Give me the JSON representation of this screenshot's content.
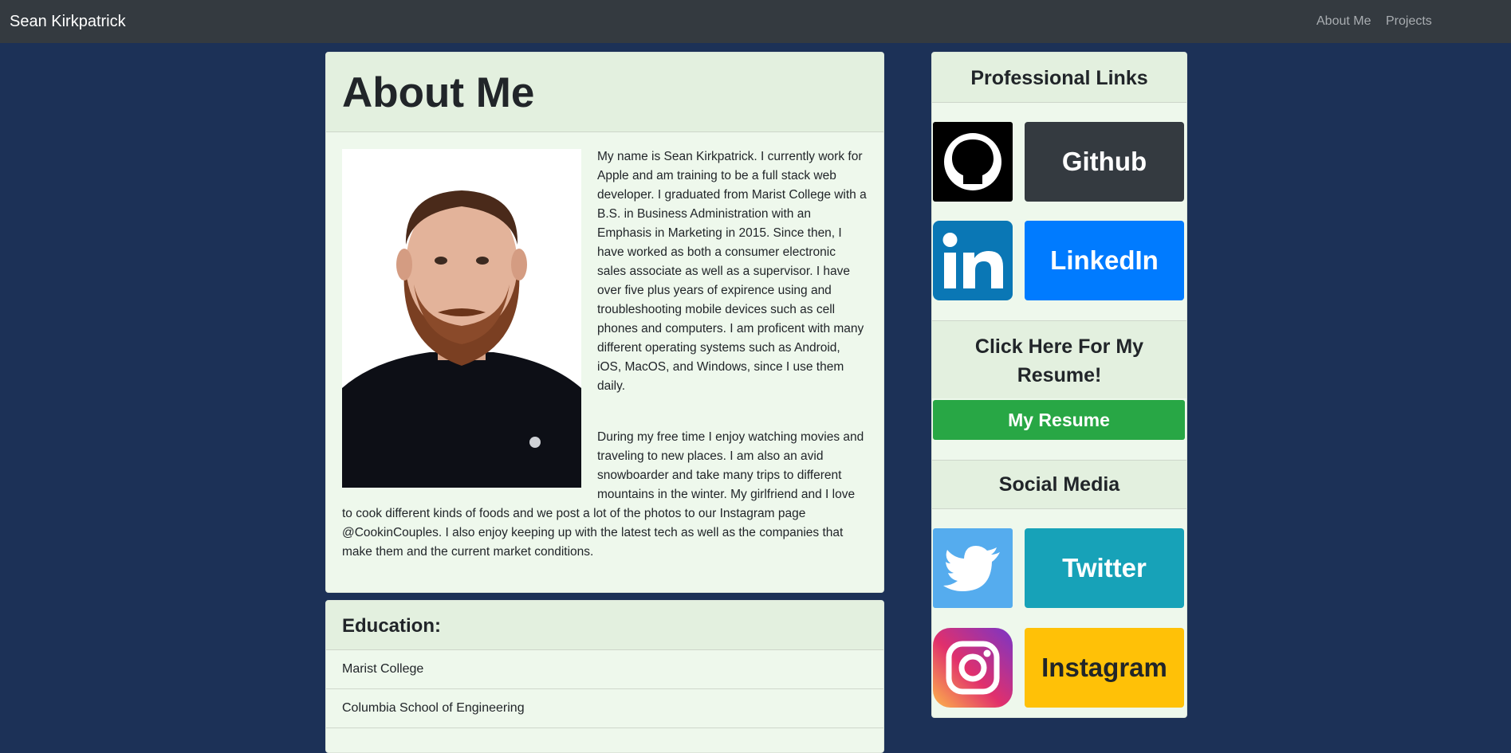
{
  "navbar": {
    "brand": "Sean Kirkpatrick",
    "links": [
      "About Me",
      "Projects"
    ]
  },
  "about": {
    "title": "About Me",
    "paragraph1": "My name is Sean Kirkpatrick. I currently work for Apple and am training to be a full stack web developer. I graduated from Marist College with a B.S. in Business Administration with an Emphasis in Marketing in 2015. Since then, I have worked as both a consumer electronic sales associate as well as a supervisor. I have over five plus years of expirence using and troubleshooting mobile devices such as cell phones and computers. I am proficent with many different operating systems such as Android, iOS, MacOS, and Windows, since I use them daily.",
    "paragraph2": "During my free time I enjoy watching movies and traveling to new places. I am also an avid snowboarder and take many trips to different mountains in the winter. My girlfriend and I love to cook different kinds of foods and we post a lot of the photos to our Instagram page @CookinCouples. I also enjoy keeping up with the latest tech as well as the companies that make them and the current market conditions."
  },
  "education": {
    "title": "Education:",
    "items": [
      "Marist College",
      "Columbia School of Engineering"
    ]
  },
  "sidebar": {
    "professional_title": "Professional Links",
    "github_label": "Github",
    "linkedin_label": "LinkedIn",
    "resume_title": "Click Here For My Resume!",
    "resume_button": "My Resume",
    "social_title": "Social Media",
    "twitter_label": "Twitter",
    "instagram_label": "Instagram"
  },
  "colors": {
    "page_bg": "#1c3157",
    "navbar": "#343a40",
    "card_bg": "#eef8ec",
    "github": "#343a40",
    "linkedin": "#007bff",
    "resume": "#28a745",
    "twitter": "#17a2b8",
    "instagram": "#ffc107"
  },
  "icons": [
    "github-icon",
    "linkedin-icon",
    "twitter-icon",
    "instagram-icon"
  ]
}
